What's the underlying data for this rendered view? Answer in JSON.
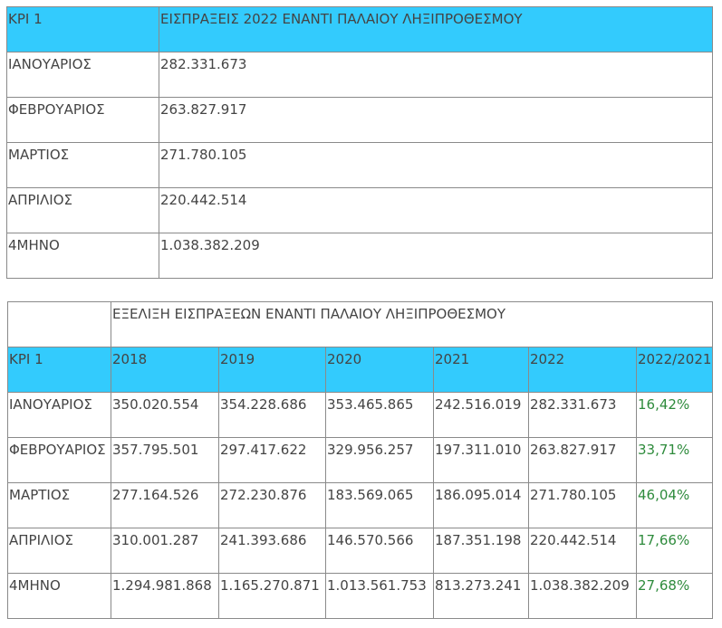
{
  "table1": {
    "header": {
      "label": "ΚΡΙ 1",
      "title": "ΕΙΣΠΡΑΞΕΙΣ 2022 ΕΝΑΝΤΙ ΠΑΛΑΙΟΥ ΛΗΞΙΠΡΟΘΕΣΜΟΥ"
    },
    "rows": [
      {
        "month": "ΙΑΝΟΥΑΡΙΟΣ",
        "value": "282.331.673"
      },
      {
        "month": "ΦΕΒΡΟΥΑΡΙΟΣ",
        "value": "263.827.917"
      },
      {
        "month": "ΜΑΡΤΙΟΣ",
        "value": "271.780.105"
      },
      {
        "month": "ΑΠΡΙΛΙΟΣ",
        "value": "220.442.514"
      },
      {
        "month": "4ΜΗΝΟ",
        "value": "1.038.382.209"
      }
    ]
  },
  "table2": {
    "title": "ΕΞΕΛΙΞΗ ΕΙΣΠΡΑΞΕΩΝ ΕΝΑΝΤΙ ΠΑΛΑΙΟΥ ΛΗΞΙΠΡΟΘΕΣΜΟΥ",
    "columns": [
      "ΚΡΙ 1",
      "2018",
      "2019",
      "2020",
      "2021",
      "2022",
      "2022/2021"
    ],
    "rows": [
      [
        "ΙΑΝΟΥΑΡΙΟΣ",
        "350.020.554",
        "354.228.686",
        "353.465.865",
        "242.516.019",
        "282.331.673",
        "16,42%"
      ],
      [
        "ΦΕΒΡΟΥΑΡΙΟΣ",
        "357.795.501",
        "297.417.622",
        "329.956.257",
        "197.311.010",
        "263.827.917",
        "33,71%"
      ],
      [
        "ΜΑΡΤΙΟΣ",
        "277.164.526",
        "272.230.876",
        "183.569.065",
        "186.095.014",
        "271.780.105",
        "46,04%"
      ],
      [
        "ΑΠΡΙΛΙΟΣ",
        "310.001.287",
        "241.393.686",
        "146.570.566",
        "187.351.198",
        "220.442.514",
        "17,66%"
      ],
      [
        "4ΜΗΝΟ",
        "1.294.981.868",
        "1.165.270.871",
        "1.013.561.753",
        "813.273.241",
        "1.038.382.209",
        "27,68%"
      ]
    ]
  },
  "colors": {
    "header_bg": "#33cbfd",
    "text": "#444444",
    "percent": "#2e8b3c",
    "border": "#8a8a8a"
  }
}
